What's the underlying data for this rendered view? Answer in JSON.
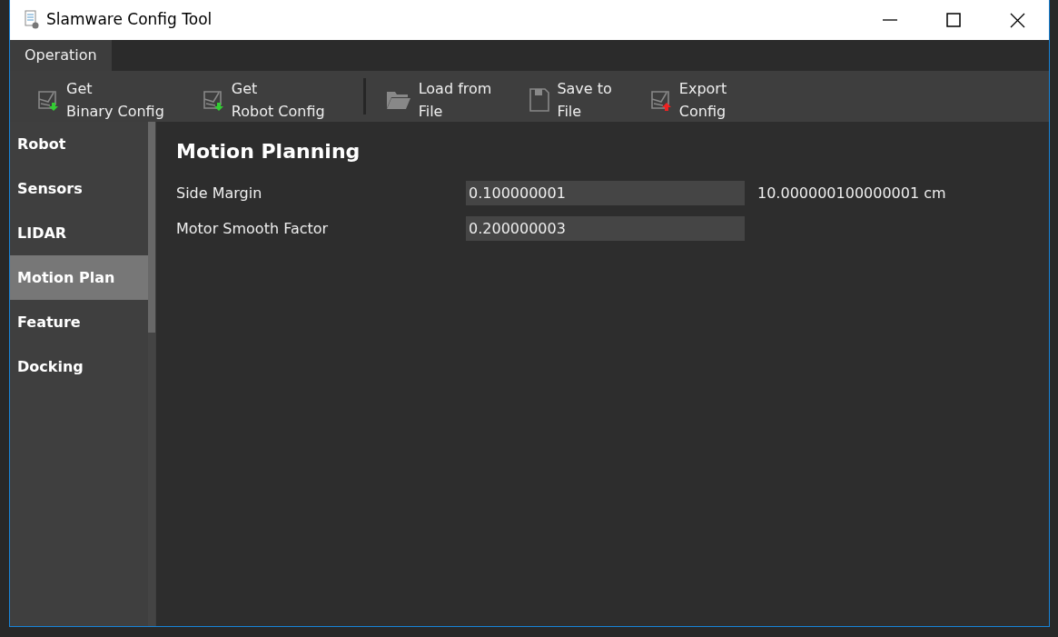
{
  "window": {
    "title": "Slamware Config Tool"
  },
  "menu": [
    {
      "label": "Operation",
      "selected": true
    }
  ],
  "toolbar": [
    {
      "kind": "get",
      "label": "Get\nBinary Config"
    },
    {
      "kind": "get",
      "label": "Get\nRobot Config"
    },
    {
      "kind": "separator"
    },
    {
      "kind": "folder",
      "label": "Load from\nFile"
    },
    {
      "kind": "save",
      "label": "Save to\nFile"
    },
    {
      "kind": "export",
      "label": "Export\nConfig"
    }
  ],
  "sidebar": {
    "items": [
      {
        "label": "Robot",
        "selected": false
      },
      {
        "label": "Sensors",
        "selected": false
      },
      {
        "label": "LIDAR",
        "selected": false
      },
      {
        "label": "Motion Plan",
        "selected": true
      },
      {
        "label": "Feature",
        "selected": false
      },
      {
        "label": "Docking",
        "selected": false
      }
    ]
  },
  "content": {
    "heading": "Motion Planning",
    "fields": [
      {
        "label": "Side Margin",
        "value": "0.100000001",
        "unit": "10.000000100000001 cm"
      },
      {
        "label": "Motor Smooth Factor",
        "value": "0.200000003"
      }
    ]
  }
}
